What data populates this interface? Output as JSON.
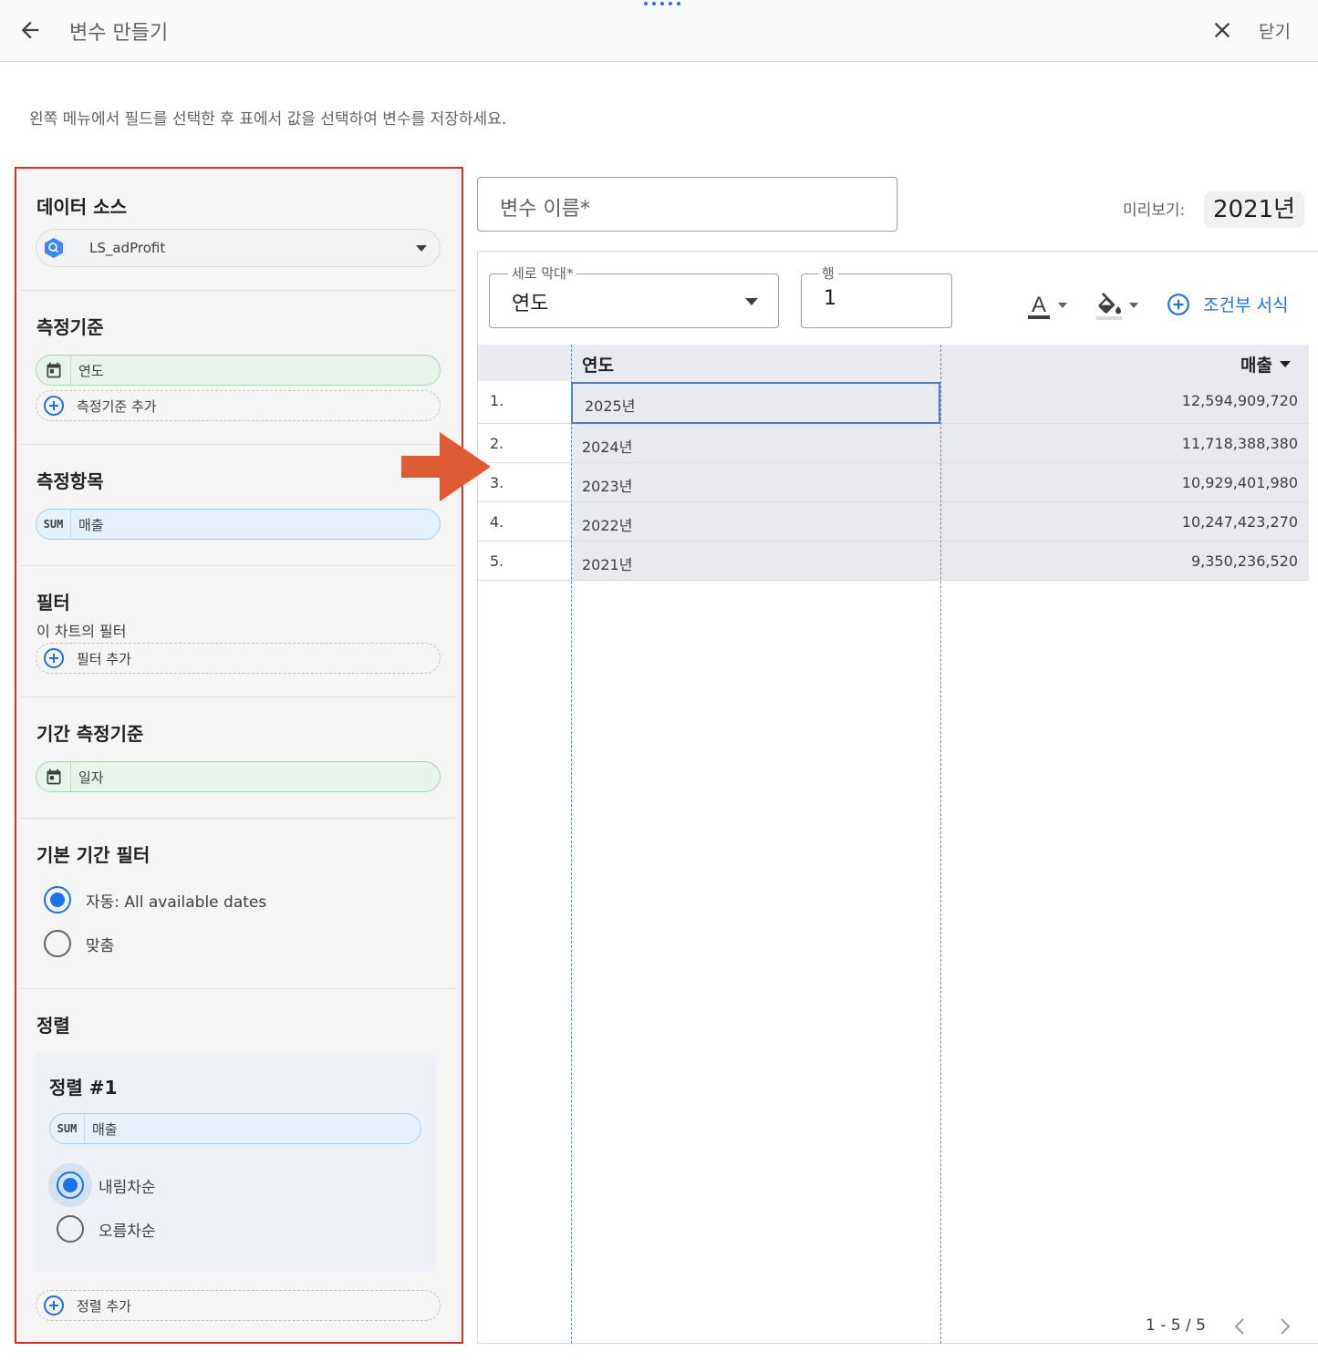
{
  "header": {
    "title": "변수 만들기",
    "close_label": "닫기"
  },
  "instruction": "왼쪽 메뉴에서 필드를 선택한 후 표에서 값을 선택하여 변수를 저장하세요.",
  "left_panel": {
    "data_source": {
      "title": "데이터 소스",
      "value": "LS_adProfit"
    },
    "dimension": {
      "title": "측정기준",
      "chip": "연도",
      "add": "측정기준 추가"
    },
    "metric": {
      "title": "측정항목",
      "agg": "SUM",
      "chip": "매출"
    },
    "filter": {
      "title": "필터",
      "subtitle": "이 차트의 필터",
      "add": "필터 추가"
    },
    "date_dimension": {
      "title": "기간 측정기준",
      "chip": "일자"
    },
    "default_date": {
      "title": "기본 기간 필터",
      "options": [
        "자동: All available dates",
        "맞춤"
      ],
      "selected": 0
    },
    "sort": {
      "title": "정렬",
      "sort1_title": "정렬 #1",
      "agg": "SUM",
      "chip": "매출",
      "options": [
        "내림차순",
        "오름차순"
      ],
      "selected": 0,
      "add": "정렬 추가"
    }
  },
  "right_panel": {
    "var_name_placeholder": "변수 이름*",
    "preview_label": "미리보기:",
    "preview_value": "2021년",
    "column_field": {
      "label": "세로 막대*",
      "value": "연도"
    },
    "row_field": {
      "label": "행",
      "value": "1"
    },
    "cond_format": "조건부 서식",
    "table": {
      "headers": [
        "연도",
        "매출"
      ],
      "rows": [
        {
          "n": "1.",
          "year": "2025년",
          "sales": "12,594,909,720"
        },
        {
          "n": "2.",
          "year": "2024년",
          "sales": "11,718,388,380"
        },
        {
          "n": "3.",
          "year": "2023년",
          "sales": "10,929,401,980"
        },
        {
          "n": "4.",
          "year": "2022년",
          "sales": "10,247,423,270"
        },
        {
          "n": "5.",
          "year": "2021년",
          "sales": "9,350,236,520"
        }
      ],
      "selected_row": 0
    },
    "pagination": "1 - 5 / 5"
  },
  "colors": {
    "accent": "#1a73e8",
    "highlight_border": "#d93025",
    "arrow": "#de5b35"
  }
}
